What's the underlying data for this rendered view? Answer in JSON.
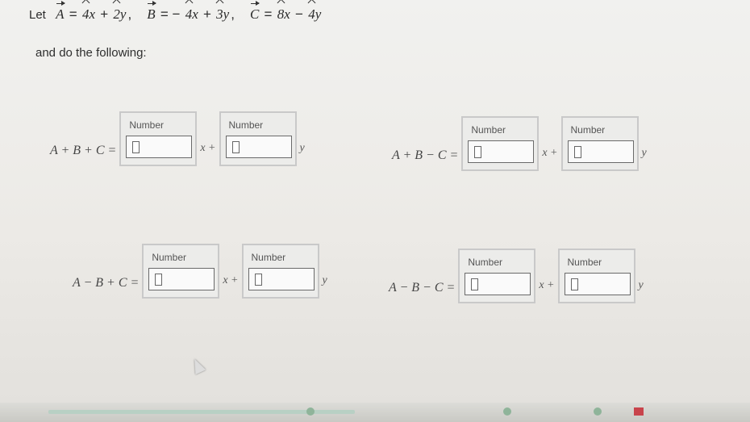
{
  "problem": {
    "let_label": "Let",
    "A": {
      "name": "A",
      "x_coef": "4x",
      "y_coef": "2y"
    },
    "B": {
      "name": "B",
      "x_coef": "4x",
      "y_coef": "3y"
    },
    "C": {
      "name": "C",
      "x_coef": "8x",
      "y_coef": "4y"
    }
  },
  "instruction": "and do the following:",
  "rows": [
    {
      "expr": "A + B + C =",
      "box_label": "Number"
    },
    {
      "expr": "A + B − C =",
      "box_label": "Number"
    },
    {
      "expr": "A − B + C =",
      "box_label": "Number"
    },
    {
      "expr": "A − B − C =",
      "box_label": "Number"
    }
  ],
  "units": {
    "x": "x +",
    "y": "y"
  }
}
